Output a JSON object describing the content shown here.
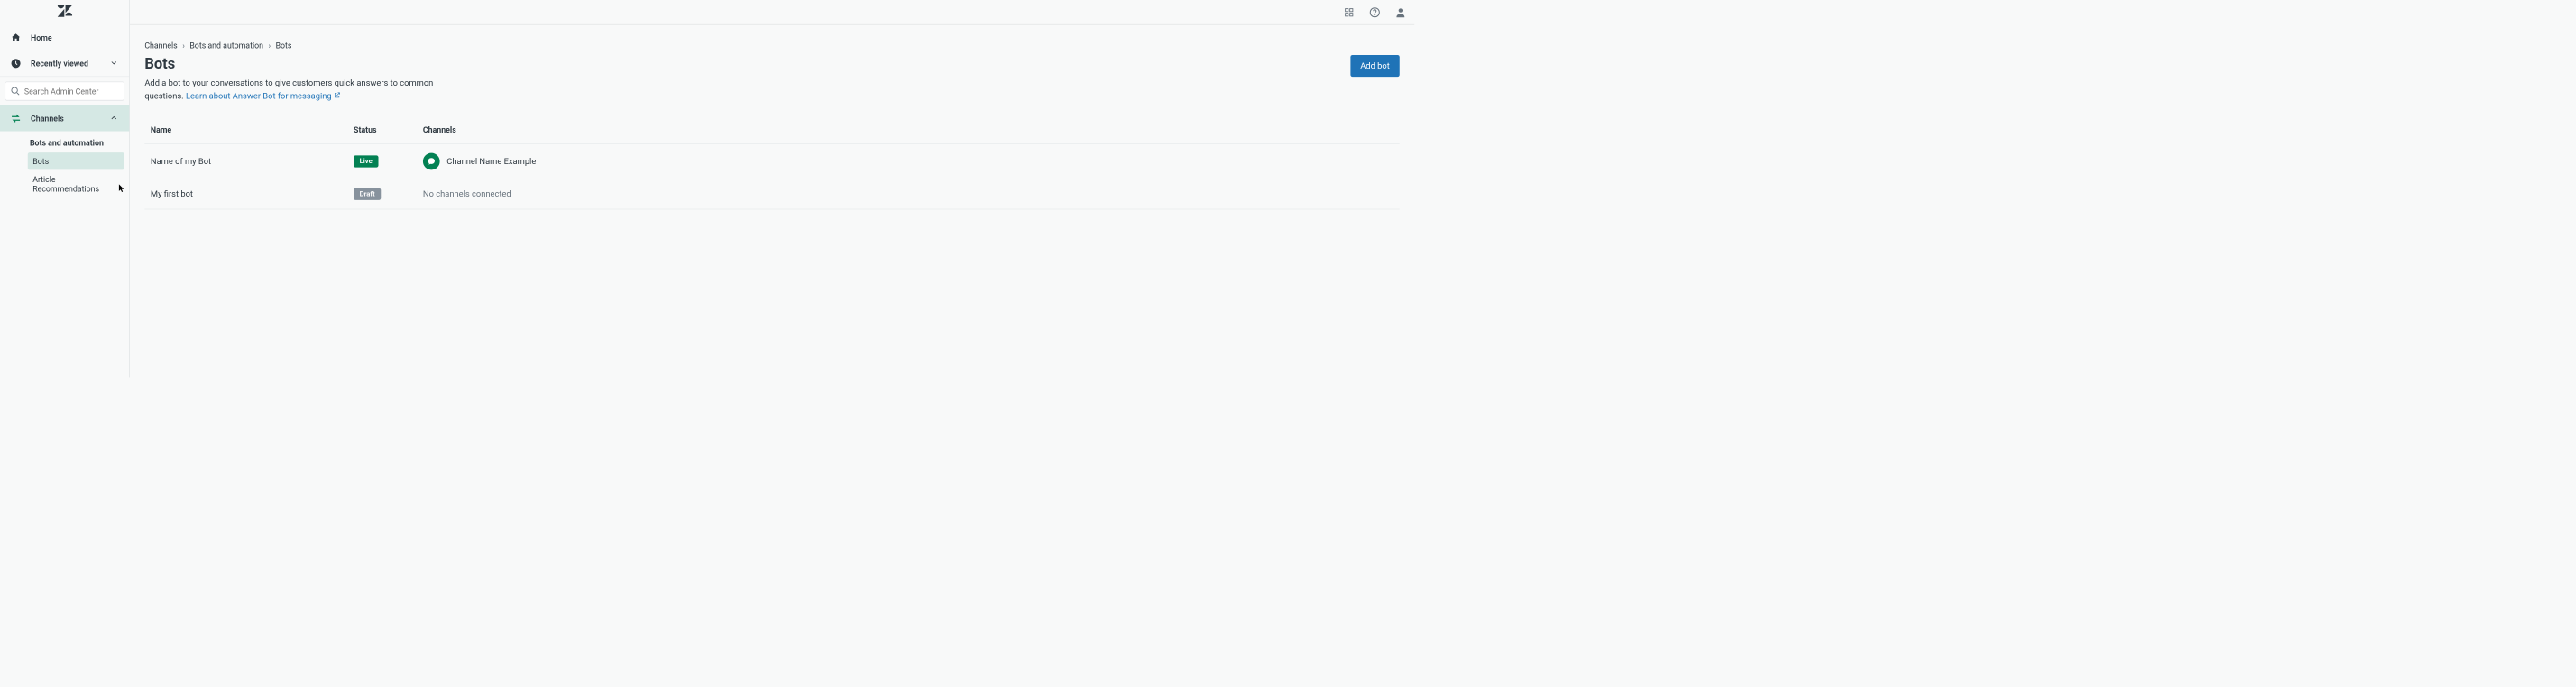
{
  "sidebar": {
    "home_label": "Home",
    "recent_label": "Recently viewed",
    "search_placeholder": "Search Admin Center",
    "channels_label": "Channels",
    "subnav_heading": "Bots and automation",
    "subnav_items": [
      {
        "label": "Bots",
        "active": true
      },
      {
        "label": "Article Recommendations",
        "active": false
      }
    ]
  },
  "breadcrumb": [
    "Channels",
    "Bots and automation",
    "Bots"
  ],
  "page": {
    "title": "Bots",
    "description_prefix": "Add a bot to your conversations to give customers quick answers to common questions. ",
    "link_text": "Learn about Answer Bot for messaging",
    "add_button": "Add bot"
  },
  "table": {
    "headers": [
      "Name",
      "Status",
      "Channels"
    ],
    "rows": [
      {
        "name": "Name of my Bot",
        "status": "Live",
        "status_kind": "live",
        "channel": "Channel Name Example",
        "has_channel": true
      },
      {
        "name": "My first bot",
        "status": "Draft",
        "status_kind": "draft",
        "channel": "No channels connected",
        "has_channel": false
      }
    ]
  },
  "colors": {
    "primary": "#1f73b7",
    "live": "#038153",
    "draft": "#87929d",
    "sidebar_active": "#d5e8e4"
  }
}
